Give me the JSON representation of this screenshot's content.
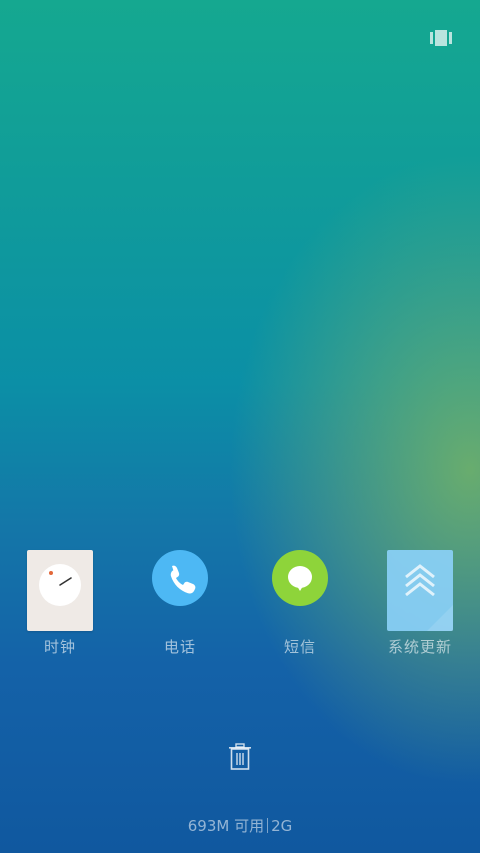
{
  "status": {
    "layout_icon": "multi-window-icon"
  },
  "recent_apps": [
    {
      "label": "时钟",
      "icon": "clock-icon",
      "color": "#efeae6"
    },
    {
      "label": "电话",
      "icon": "phone-icon",
      "color": "#4db8f4"
    },
    {
      "label": "短信",
      "icon": "message-icon",
      "color": "#8ed43a"
    },
    {
      "label": "系统更新",
      "icon": "system-update-icon",
      "color": "#8cd2fa"
    }
  ],
  "footer": {
    "trash_icon": "trash-icon",
    "memory_available": "693M 可用",
    "memory_total": "2G"
  }
}
